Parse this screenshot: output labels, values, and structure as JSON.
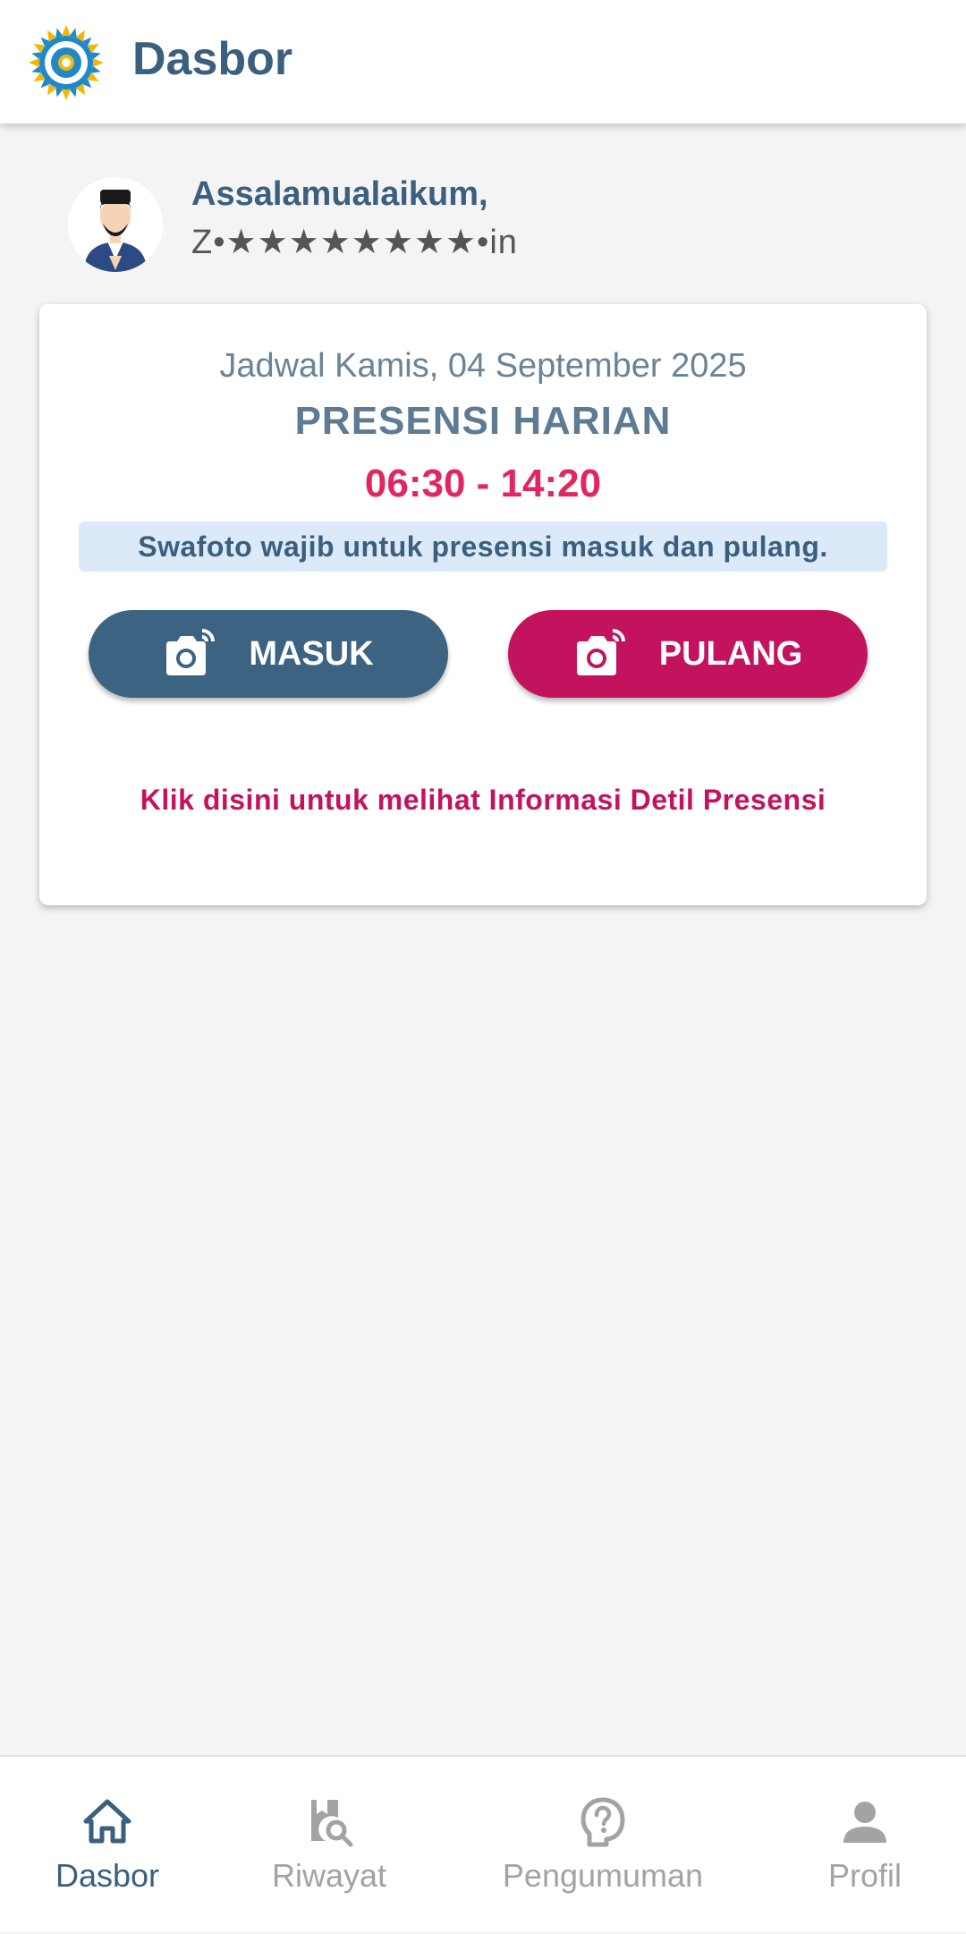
{
  "header": {
    "title": "Dasbor",
    "logo_icon": "organization-logo-icon"
  },
  "greeting": {
    "salam": "Assalamualaikum,",
    "username": "Z•★★★★★★★★•in"
  },
  "card": {
    "schedule_date": "Jadwal Kamis, 04 September 2025",
    "title": "PRESENSI HARIAN",
    "time_range": "06:30 - 14:20",
    "notice": "Swafoto wajib untuk presensi masuk dan pulang.",
    "masuk_label": "MASUK",
    "pulang_label": "PULANG",
    "detail_link": "Klik disini untuk melihat Informasi Detil Presensi"
  },
  "bottom_nav": {
    "items": [
      {
        "label": "Dasbor",
        "icon": "home-icon",
        "active": true
      },
      {
        "label": "Riwayat",
        "icon": "history-search-icon",
        "active": false
      },
      {
        "label": "Pengumuman",
        "icon": "help-question-icon",
        "active": false
      },
      {
        "label": "Profil",
        "icon": "person-icon",
        "active": false
      }
    ]
  },
  "colors": {
    "primary": "#3b5f7e",
    "accent": "#c4135e",
    "time_highlight": "#e3275e",
    "notice_bg": "#dbe9f9",
    "background": "#f4f4f4"
  }
}
